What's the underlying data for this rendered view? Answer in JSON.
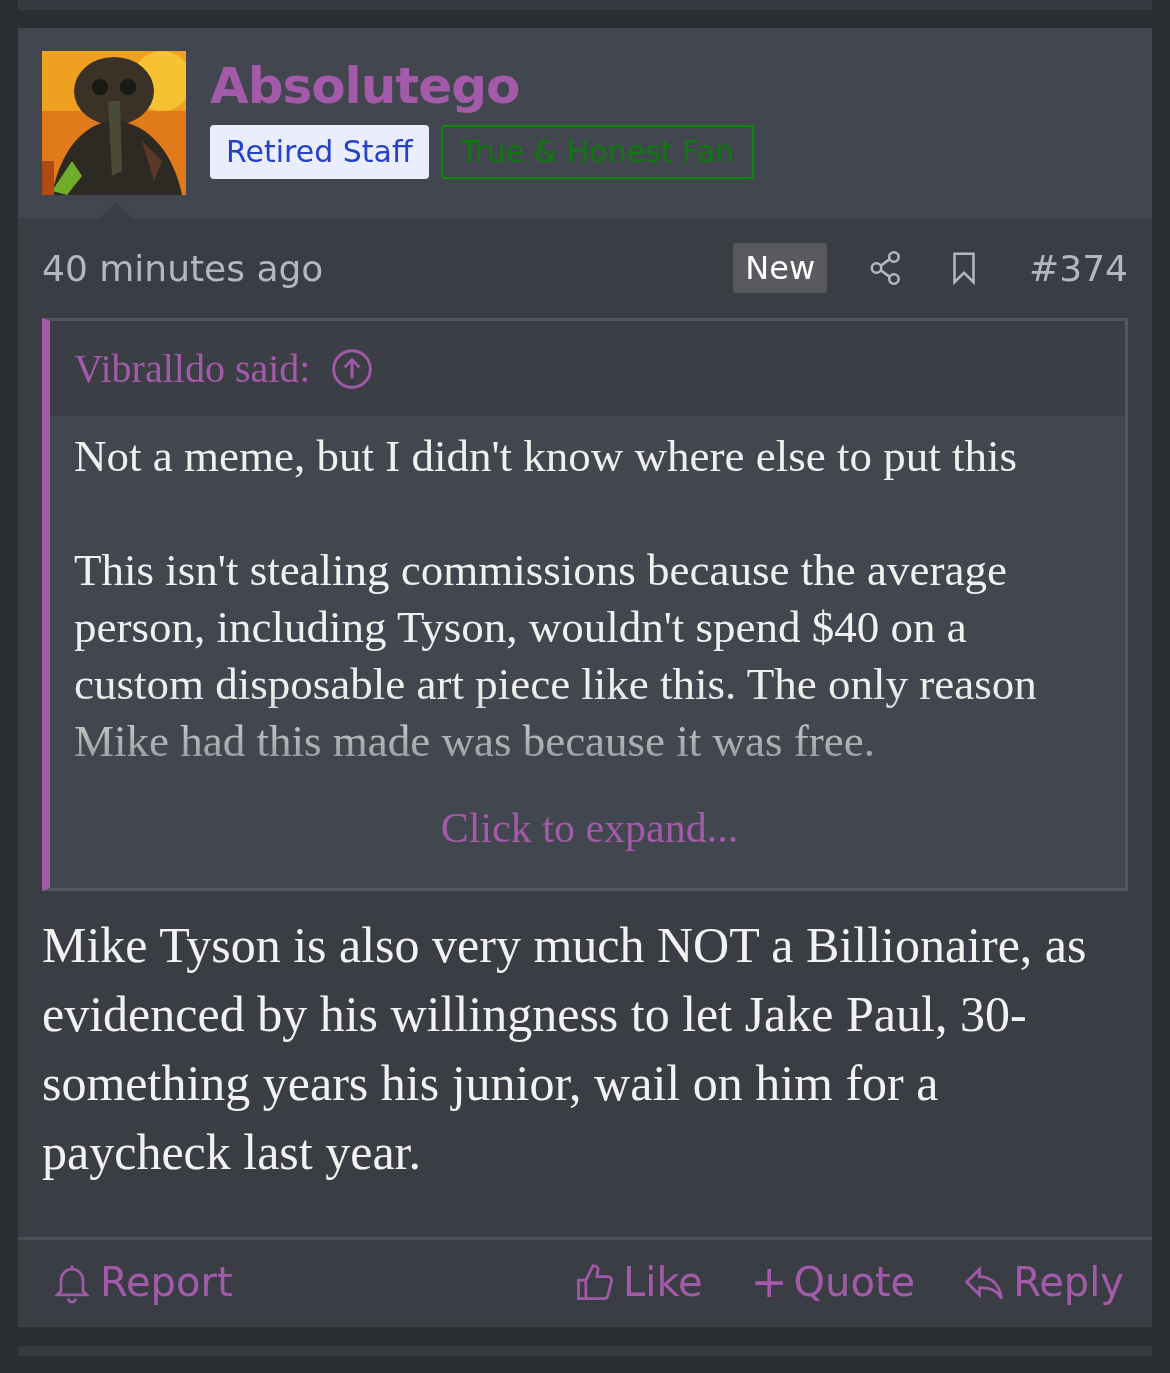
{
  "post": {
    "author": "Absolutego",
    "badges": [
      {
        "label": "Retired Staff",
        "kind": "filled"
      },
      {
        "label": "True & Honest Fan",
        "kind": "outline"
      }
    ],
    "time": "40 minutes ago",
    "new_label": "New",
    "number": "#374",
    "quote": {
      "author": "Vibralldo said:",
      "paragraphs": [
        "Not a meme, but I didn't know where else to put this",
        "This isn't stealing commissions because the average person, including Tyson, wouldn't spend $40 on a custom disposable art piece like this. The only reason Mike had this made was because it was free."
      ],
      "expand": "Click to expand..."
    },
    "body": "Mike Tyson is also very much NOT a Billionaire, as evidenced by his willingness to let Jake Paul, 30-something years his junior, wail on him for a paycheck last year.",
    "actions": [
      {
        "label": "Report",
        "kind": "report"
      },
      {
        "label": "Like",
        "kind": "like"
      },
      {
        "label": "Quote",
        "kind": "quote",
        "glyph": "+"
      },
      {
        "label": "Reply",
        "kind": "reply"
      }
    ]
  }
}
